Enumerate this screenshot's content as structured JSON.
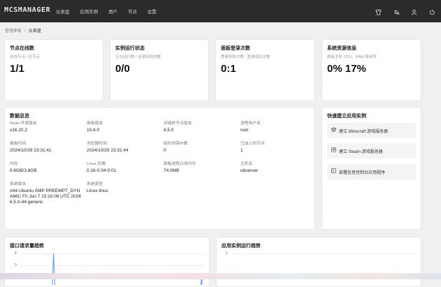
{
  "app": {
    "logo": "MCSMANAGER",
    "nav": [
      "仪表盘",
      "应用实例",
      "用户",
      "节点",
      "设置"
    ],
    "icons": [
      "shirt-icon",
      "language-icon",
      "user-icon",
      "power-icon"
    ]
  },
  "breadcrumb": {
    "parent": "管理面板",
    "separator": "/",
    "current": "仪表盘"
  },
  "stats": [
    {
      "title": "节点在线数",
      "sub": "在线节点 / 总节点",
      "value": "1/1"
    },
    {
      "title": "实例运行状态",
      "sub": "正在运行数 / 全部实例总数",
      "value": "0/0"
    },
    {
      "title": "面板登录次数",
      "sub": "登录失败次数 : 登录成功次数",
      "value": "0:1"
    },
    {
      "title": "系统资源信息",
      "sub": "面板主机 CPU，RAM 使用率",
      "value": "0% 17%"
    }
  ],
  "overview": {
    "title": "数据总览",
    "items": [
      {
        "k": "Node 环境版本",
        "v": "v16.20.2"
      },
      {
        "k": "面板版本",
        "v": "10.4.0"
      },
      {
        "k": "对接的节点版本",
        "v": "4.5.0"
      },
      {
        "k": "进程用户名",
        "v": "root"
      },
      {
        "k": "面板时间",
        "v": "2024/10/29 23:31:41"
      },
      {
        "k": "浏览器时间",
        "v": "2024/10/29 23:31:44"
      },
      {
        "k": "临时封禁IP数",
        "v": "0"
      },
      {
        "k": "已加入的节点",
        "v": "1"
      },
      {
        "k": "内存",
        "v": "0.6GB/3.8GB"
      },
      {
        "k": "Linux 负载",
        "v": "0.16-0.04-0.01"
      },
      {
        "k": "面板进程占用内存",
        "v": "74.0MB"
      },
      {
        "k": "主机名",
        "v": "ubserver"
      },
      {
        "k": "系统版本",
        "v": "#44-Ubuntu SMP PREEMPT_DYNAMIC Fri Jun 7 15:10:09 UTC 2024 6.5.0-44-generic"
      },
      {
        "k": "系统类型",
        "v": "Linux linux"
      }
    ]
  },
  "quick": {
    "title": "快速建立应用实例",
    "buttons": [
      {
        "label": "建立 Minecraft 游戏服务器",
        "icon": "cube-icon"
      },
      {
        "label": "建立 Steam 游戏服务器",
        "icon": "steam-icon"
      },
      {
        "label": "部署任意控制台应用程序",
        "icon": "terminal-icon"
      }
    ]
  },
  "charts": {
    "left_title": "接口请求量趋势",
    "right_title": "应用实例运行趋势",
    "left_ticks": [
      "4",
      "3"
    ],
    "right_ticks": [
      "1"
    ]
  },
  "chart_data": [
    {
      "type": "line",
      "title": "接口请求量趋势",
      "y_ticks": [
        3,
        4
      ],
      "series": [
        {
          "values": [
            0,
            0,
            0,
            0,
            0,
            0,
            0,
            0,
            0,
            0,
            0,
            0,
            0,
            0,
            0,
            0,
            0,
            0,
            4,
            0,
            0,
            0,
            0,
            0,
            0,
            0,
            0,
            0,
            0,
            0,
            0,
            0,
            0,
            0,
            0,
            0,
            0,
            0,
            0,
            0,
            0,
            0,
            0,
            0,
            0,
            0,
            0,
            0,
            0,
            0,
            0,
            0,
            0,
            0,
            0,
            0,
            0,
            0,
            0,
            0,
            0,
            0,
            0,
            0,
            0,
            0,
            0,
            0,
            0,
            0,
            0,
            0,
            0,
            0,
            0,
            0,
            0,
            0,
            0,
            0,
            0,
            0,
            0,
            0,
            0,
            0,
            0,
            0,
            0,
            0,
            0,
            0,
            0,
            0,
            0,
            0,
            0,
            0,
            2,
            0
          ]
        }
      ]
    },
    {
      "type": "line",
      "title": "应用实例运行趋势",
      "y_ticks": [
        1
      ],
      "series": []
    }
  ]
}
